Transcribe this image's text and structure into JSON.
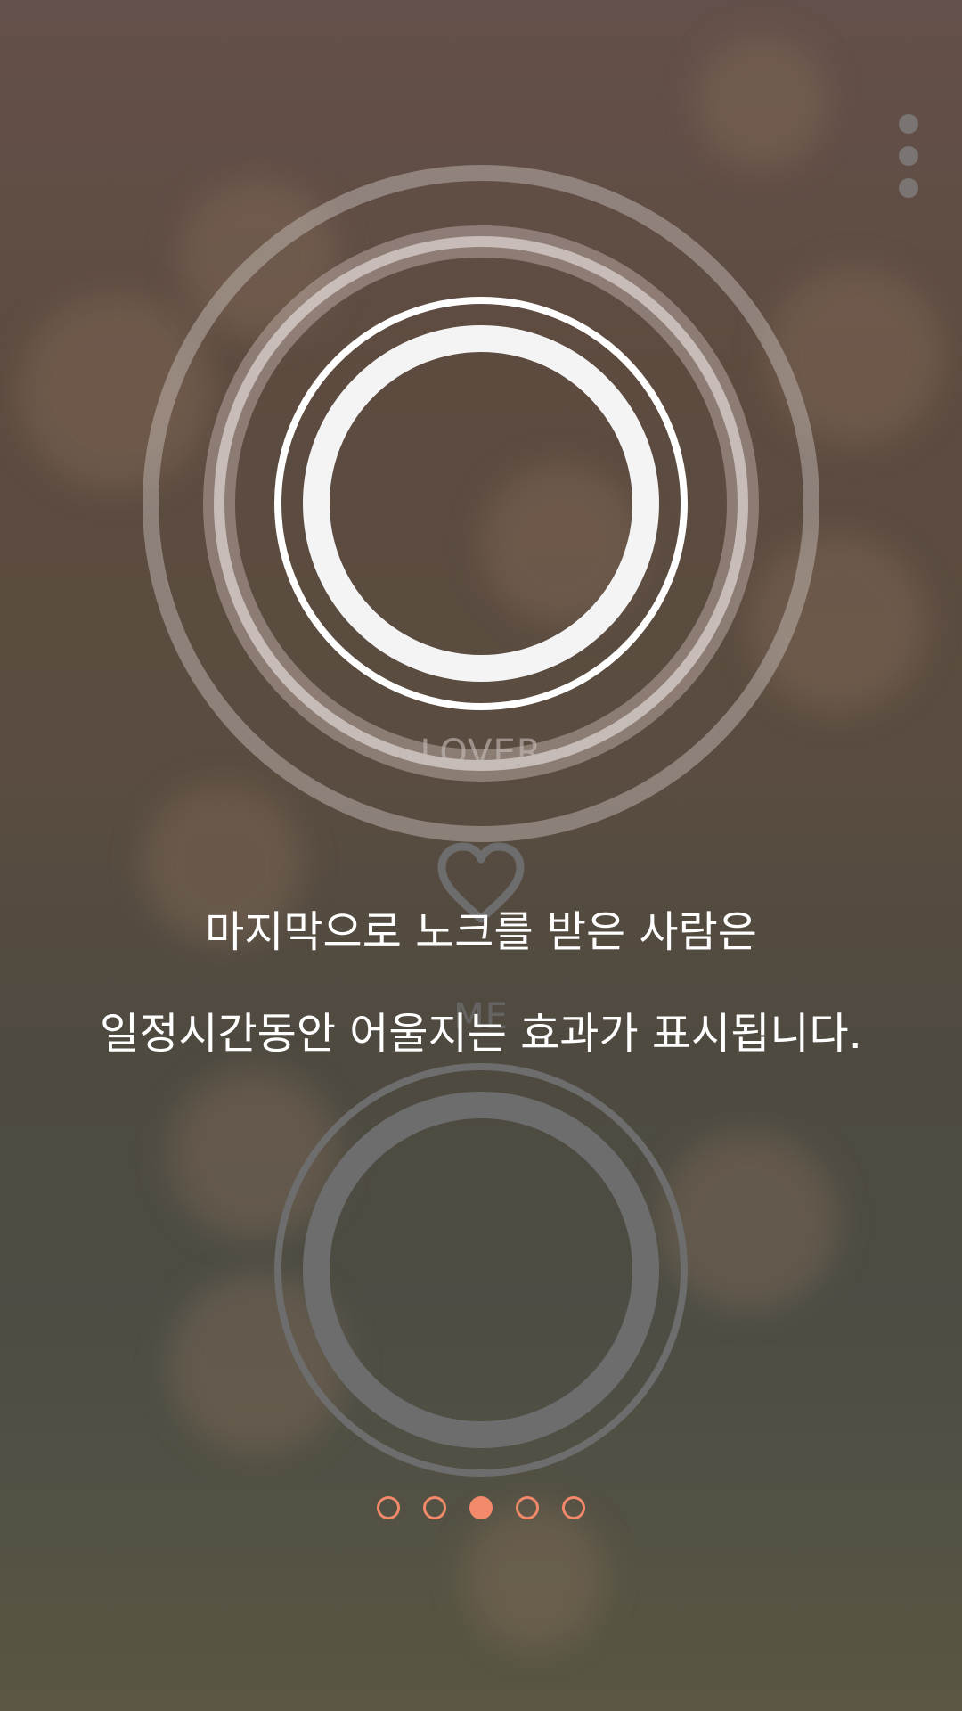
{
  "lover_circle": {
    "label": "LOVER"
  },
  "me_circle": {
    "label": "ME"
  },
  "heart": {
    "icon": "heart-outline-icon"
  },
  "caption": {
    "line1": "마지막으로 노크를 받은 사람은",
    "line2": "일정시간동안 어울지는 효과가 표시됩니다."
  },
  "menu": {
    "icon": "more-vertical-icon"
  },
  "pagination": {
    "total": 5,
    "active_index": 2
  },
  "colors": {
    "accent": "#f3896b",
    "ring_active": "#ffffff",
    "ring_inactive": "#6e6d6d",
    "menu_dots": "#7a7572"
  }
}
